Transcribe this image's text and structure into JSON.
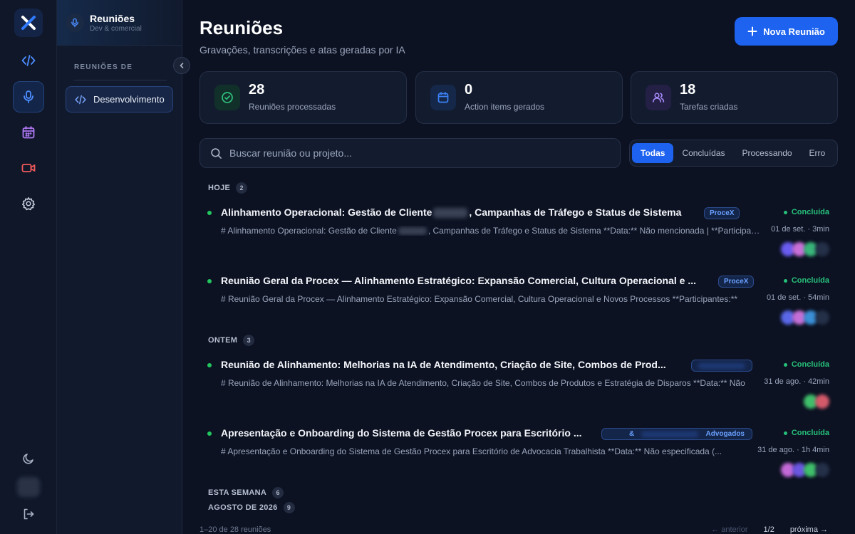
{
  "brand": {
    "logo_icon": "x-logo-icon",
    "accent": "#1d63f0"
  },
  "rail": {
    "items": [
      {
        "name": "code-icon"
      },
      {
        "name": "microphone-icon",
        "active": true
      },
      {
        "name": "calendar-icon"
      },
      {
        "name": "video-icon"
      },
      {
        "name": "gear-icon"
      }
    ],
    "bottom": [
      "moon-icon",
      "avatar",
      "logout-icon"
    ]
  },
  "panel": {
    "title": "Reuniões",
    "subtitle": "Dev & comercial",
    "section_label": "REUNIÕES DE",
    "nav_item": "Desenvolvimento"
  },
  "header": {
    "title": "Reuniões",
    "subtitle": "Gravações, transcrições e atas geradas por IA",
    "new_button": "Nova Reunião"
  },
  "stats": [
    {
      "value": "28",
      "label": "Reuniões processadas",
      "icon": "check-circle-icon",
      "color": "#2ec27e"
    },
    {
      "value": "0",
      "label": "Action items gerados",
      "icon": "calendar-icon",
      "color": "#3b82f6"
    },
    {
      "value": "18",
      "label": "Tarefas criadas",
      "icon": "users-icon",
      "color": "#a78bfa"
    }
  ],
  "search": {
    "placeholder": "Buscar reunião ou projeto..."
  },
  "filters": [
    "Todas",
    "Concluídas",
    "Processando",
    "Erro"
  ],
  "groups": [
    {
      "label": "HOJE",
      "count": "2"
    },
    {
      "label": "ONTEM",
      "count": "3"
    },
    {
      "label": "ESTA SEMANA",
      "count": "6"
    },
    {
      "label": "AGOSTO DE 2026",
      "count": "9"
    }
  ],
  "meetings": [
    {
      "title_a": "Alinhamento Operacional: Gestão de Cliente",
      "title_b": ", Campanhas de Tráfego e Status de Sistema",
      "tag": "ProceX",
      "status": "Concluída",
      "snippet_a": "# Alinhamento Operacional: Gestão de Cliente",
      "snippet_b": ", Campanhas de Tráfego e Status de Sistema **Data:** Não mencionada | **Participantes:**",
      "meta": "01 de set. · 3min"
    },
    {
      "title": "Reunião Geral da Procex — Alinhamento Estratégico: Expansão Comercial, Cultura Operacional e ...",
      "tag": "ProceX",
      "status": "Concluída",
      "snippet": "# Reunião Geral da Procex — Alinhamento Estratégico: Expansão Comercial, Cultura Operacional e Novos Processos **Participantes:**",
      "meta": "01 de set. · 54min"
    },
    {
      "title": "Reunião de Alinhamento: Melhorias na IA de Atendimento, Criação de Site, Combos de Prod...",
      "tag": "",
      "status": "Concluída",
      "snippet": "# Reunião de Alinhamento: Melhorias na IA de Atendimento, Criação de Site, Combos de Produtos e Estratégia de Disparos **Data:** Não",
      "meta": "31 de ago. · 42min"
    },
    {
      "title": "Apresentação e Onboarding do Sistema de Gestão Procex para Escritório ...",
      "tag_a": "&",
      "tag_b": "Advogados",
      "status": "Concluída",
      "snippet": "# Apresentação e Onboarding do Sistema de Gestão Procex para Escritório de Advocacia Trabalhista **Data:** Não especificada (...",
      "meta": "31 de ago. · 1h 4min"
    }
  ],
  "footer": {
    "range": "1–20 de 28 reuniões",
    "prev": "← anterior",
    "page": "1/2",
    "next": "próxima →"
  }
}
